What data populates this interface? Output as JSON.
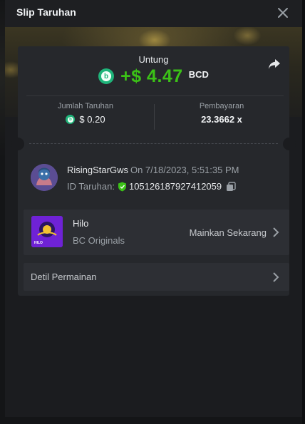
{
  "modal": {
    "title": "Slip Taruhan"
  },
  "icons": {
    "close": "close-icon",
    "share": "share-icon",
    "coin": "bcd-coin-icon",
    "shield": "verified-shield-icon",
    "copy": "copy-icon",
    "chevron": "chevron-right-icon"
  },
  "colors": {
    "profit": "#3bc117",
    "coin": "#1fb47a",
    "card": "#26282c"
  },
  "summary": {
    "profit_label": "Untung",
    "profit_amount": "+$ 4.47",
    "currency": "BCD"
  },
  "stats": {
    "bet_label": "Jumlah Taruhan",
    "bet_value": "$ 0.20",
    "payout_label": "Pembayaran",
    "payout_value": "23.3662 x"
  },
  "player": {
    "name": "RisingStarGws",
    "date": "On 7/18/2023, 5:51:35 PM",
    "bet_id_label": "ID Taruhan:",
    "bet_id": "105126187927412059"
  },
  "game": {
    "name": "Hilo",
    "provider": "BC Originals",
    "play_label": "Mainkan Sekarang",
    "thumb_label": "HILO"
  },
  "details": {
    "label": "Detil Permainan"
  }
}
